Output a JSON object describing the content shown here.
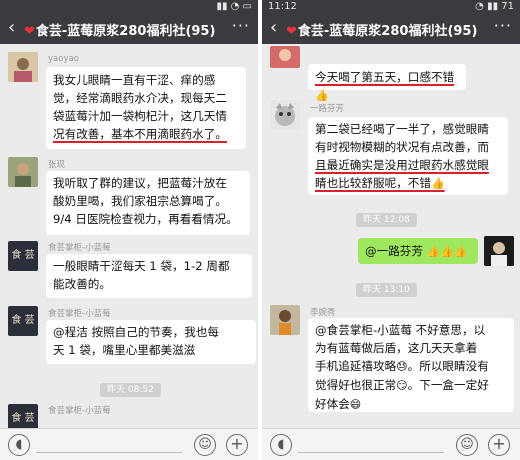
{
  "left": {
    "status_time": "",
    "status_right": "",
    "title": "食芸-蓝莓原浆280福利社(95)",
    "messages": [
      {
        "name": "yaoyao",
        "lines": [
          "我女儿眼睛一直有干涩、痒的感",
          "觉，经常滴眼药水介决，现每天二",
          "袋蓝莓汁加一袋枸杞汁，这几天情",
          "况有改善，基本不用滴眼药水了。"
        ]
      },
      {
        "name": "张现",
        "lines": [
          "我听取了群的建议，把蓝莓汁放在",
          "酸奶里喝，我们家祖宗总算喝了。",
          "9/4 日医院检查视力，再看看情况。"
        ]
      },
      {
        "name": "食芸掌柜-小蓝莓",
        "lines": [
          "一般眼睛干涩每天 1 袋，1-2 周都",
          "能改善的。"
        ]
      },
      {
        "name": "食芸掌柜-小蓝莓",
        "lines": [
          "@程洁  按照自己的节奏，我也每",
          "天 1 袋，嘴里心里都美滋滋"
        ]
      },
      {
        "name": "食芸掌柜-小蓝莓",
        "lines": []
      }
    ],
    "time_chip": "昨天 08:52",
    "seal_text": "食 芸"
  },
  "right": {
    "status_time": "11:12",
    "status_right": "71",
    "title": "食芸-蓝莓原浆280福利社(95)",
    "msg1": {
      "name": "",
      "text": "今天喝了第五天，口感不错"
    },
    "msg2": {
      "name": "一路芬芳",
      "lines": [
        "第二袋已经喝了一半了，感觉眼睛",
        "有时视物模糊的状况有点改善，而",
        "且最近确实是没用过眼药水感觉眼",
        "睛也比较舒服呢，不错"
      ]
    },
    "chip1": "昨天 12:08",
    "self_msg": "@一路芬芳",
    "chip2": "昨天 13:10",
    "msg3": {
      "name": "李婉秀",
      "lines": [
        "@食芸掌柜-小蓝莓  不好意思，以",
        "为有蓝莓做后盾，这几天天拿着",
        "手机追延禧攻略",
        "。所以眼睛没有",
        "觉得好也很正常",
        "。下一盒一定好",
        "好体会"
      ]
    }
  },
  "colors": {
    "header": "#3a3a3f",
    "chat_bg": "#ebebeb",
    "self_bubble": "#9fe75d",
    "underline": "#d8212c"
  }
}
